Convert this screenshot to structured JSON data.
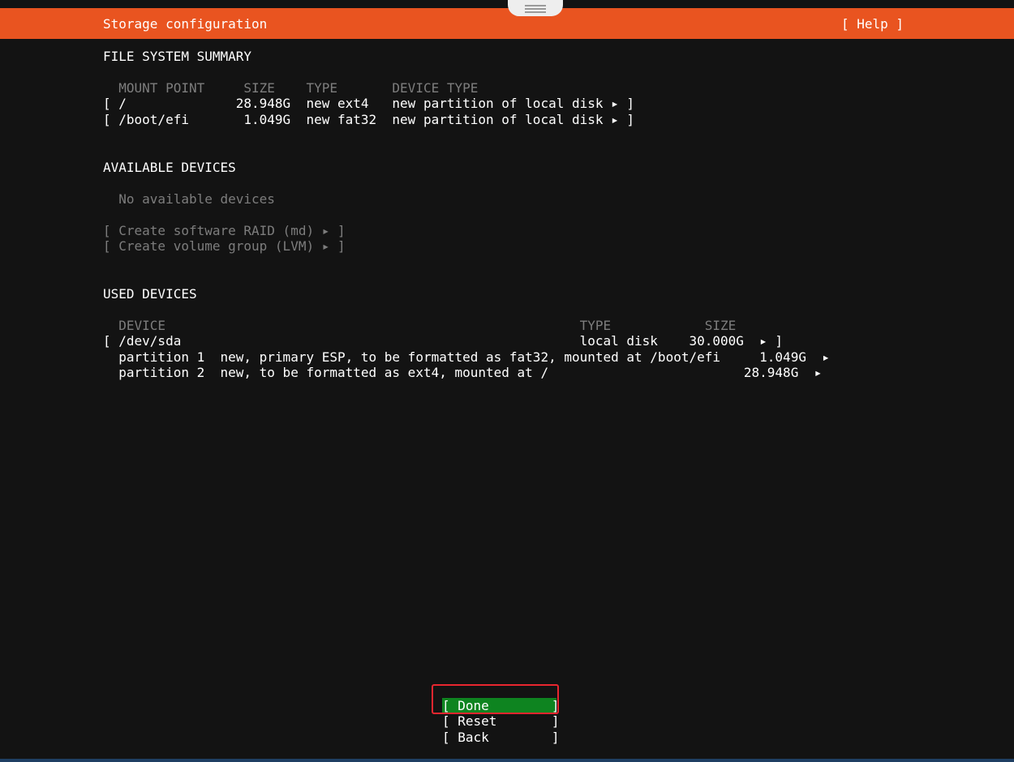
{
  "colors": {
    "header_bg": "#e95420",
    "background": "#131313",
    "selected_button": "#0e8420",
    "dim_text": "#7d7d7d",
    "highlight_box": "#e8262f"
  },
  "header": {
    "title": "Storage configuration",
    "help": "[ Help ]"
  },
  "fs_summary": {
    "heading": "FILE SYSTEM SUMMARY",
    "columns_line": "  MOUNT POINT     SIZE    TYPE       DEVICE TYPE",
    "rows": [
      "[ /              28.948G  new ext4   new partition of local disk ▸ ]",
      "[ /boot/efi       1.049G  new fat32  new partition of local disk ▸ ]"
    ]
  },
  "available": {
    "heading": "AVAILABLE DEVICES",
    "empty": "  No available devices",
    "actions": [
      "[ Create software RAID (md) ▸ ]",
      "[ Create volume group (LVM) ▸ ]"
    ]
  },
  "used": {
    "heading": "USED DEVICES",
    "columns_line": "  DEVICE                                                     TYPE            SIZE",
    "rows": [
      "[ /dev/sda                                                   local disk    30.000G  ▸ ]",
      "  partition 1  new, primary ESP, to be formatted as fat32, mounted at /boot/efi     1.049G  ▸",
      "  partition 2  new, to be formatted as ext4, mounted at /                         28.948G  ▸"
    ]
  },
  "buttons": {
    "done": "[ Done        ]",
    "reset": "[ Reset       ]",
    "back": "[ Back        ]"
  }
}
